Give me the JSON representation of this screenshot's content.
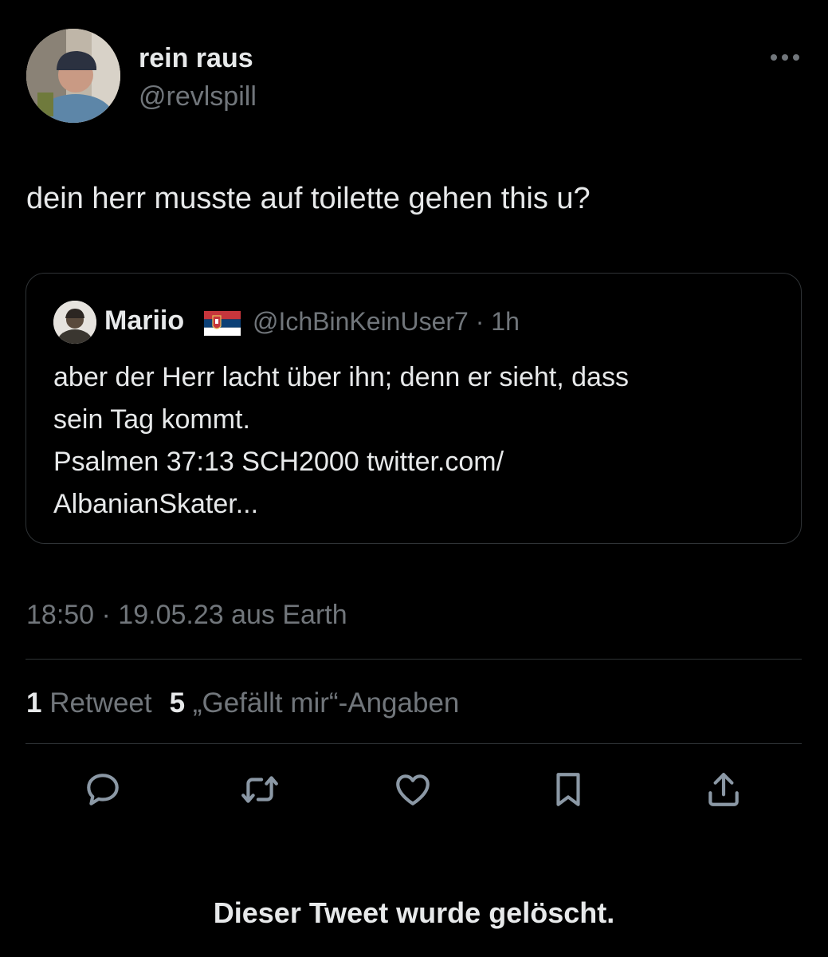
{
  "author": {
    "name": "rein raus",
    "handle": "@revlspill"
  },
  "tweet": {
    "text": "dein herr musste auf toilette gehen this u?",
    "timestamp": "18:50 · 19.05.23 aus Earth"
  },
  "quoted_tweet": {
    "name": "Mariio",
    "flag": "serbian-flag",
    "meta": "@IchBinKeinUser7 · 1h",
    "lines": [
      "aber der Herr lacht über ihn; denn er sieht, dass",
      "sein Tag kommt.",
      "Psalmen 37:13 SCH2000 twitter.com/",
      "AlbanianSkater..."
    ]
  },
  "stats": {
    "retweet_count": "1",
    "retweet_label": "Retweet",
    "like_count": "5",
    "like_label": "„Gefällt mir“-Angaben"
  },
  "actions": [
    "reply-icon",
    "retweet-icon",
    "like-icon",
    "bookmark-icon",
    "share-icon"
  ],
  "footer": {
    "deleted_notice": "Dieser Tweet wurde gelöscht."
  },
  "colors": {
    "background": "#000000",
    "text": "#e7e9ea",
    "secondary": "#71767b",
    "border": "#2f3336"
  }
}
